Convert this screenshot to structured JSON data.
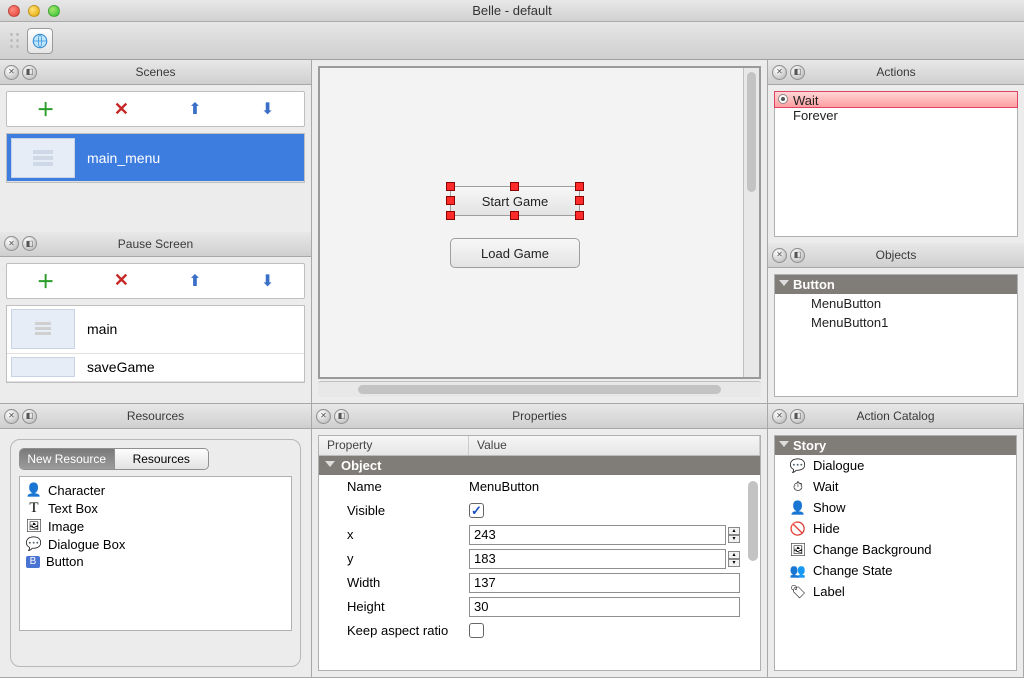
{
  "window": {
    "title": "Belle - default"
  },
  "panels": {
    "scenes": "Scenes",
    "pause": "Pause Screen",
    "resources": "Resources",
    "properties": "Properties",
    "actions": "Actions",
    "objects": "Objects",
    "catalog": "Action Catalog"
  },
  "scenes": {
    "items": [
      {
        "name": "main_menu",
        "selected": true
      }
    ]
  },
  "pause": {
    "items": [
      {
        "name": "main"
      },
      {
        "name": "saveGame"
      }
    ]
  },
  "canvas": {
    "buttons": [
      {
        "label": "Start Game",
        "selected": true
      },
      {
        "label": "Load Game",
        "selected": false
      }
    ]
  },
  "actions": {
    "items": [
      {
        "label": "Wait",
        "selected": true
      },
      {
        "label": "Forever",
        "selected": false
      }
    ]
  },
  "objects": {
    "group": "Button",
    "items": [
      "MenuButton",
      "MenuButton1"
    ]
  },
  "resources": {
    "tabs": {
      "newResource": "New Resource",
      "resources": "Resources"
    },
    "items": [
      "Character",
      "Text Box",
      "Image",
      "Dialogue Box",
      "Button"
    ]
  },
  "properties": {
    "col1": "Property",
    "col2": "Value",
    "section": "Object",
    "rows": {
      "name": {
        "k": "Name",
        "v": "MenuButton"
      },
      "visible": {
        "k": "Visible",
        "v": true
      },
      "x": {
        "k": "x",
        "v": "243"
      },
      "y": {
        "k": "y",
        "v": "183"
      },
      "width": {
        "k": "Width",
        "v": "137"
      },
      "height": {
        "k": "Height",
        "v": "30"
      },
      "keepAspect": {
        "k": "Keep aspect ratio",
        "v": false
      }
    }
  },
  "catalog": {
    "section": "Story",
    "items": [
      "Dialogue",
      "Wait",
      "Show",
      "Hide",
      "Change Background",
      "Change State",
      "Label"
    ]
  }
}
